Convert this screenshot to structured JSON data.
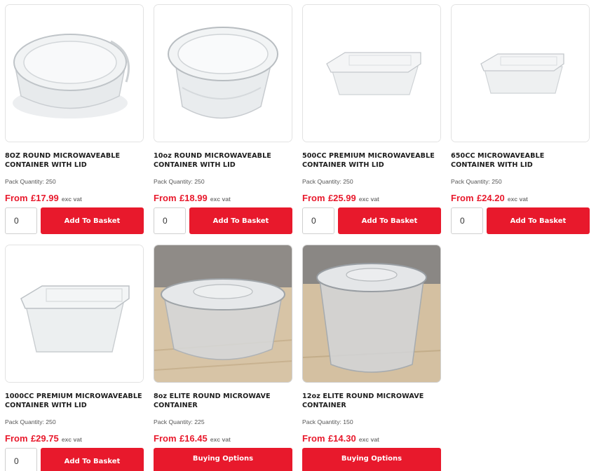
{
  "common": {
    "qty_value": "0",
    "add_to_basket": "Add To Basket",
    "buying_options": "Buying Options",
    "from_label": "From",
    "exc_vat": "exc vat",
    "pack_label": "Pack Quantity:"
  },
  "products": [
    {
      "title": "8OZ ROUND MICROWAVEABLE CONTAINER WITH LID",
      "pack_qty": "250",
      "price": "£17.99",
      "image": "round-container-white",
      "action": "add_to_basket"
    },
    {
      "title": "10oz ROUND MICROWAVEABLE CONTAINER WITH LID",
      "pack_qty": "250",
      "price": "£18.99",
      "image": "round-container-white",
      "action": "add_to_basket"
    },
    {
      "title": "500CC PREMIUM MICROWAVEABLE CONTAINER WITH LID",
      "pack_qty": "250",
      "price": "£25.99",
      "image": "rectangular-container-small",
      "action": "add_to_basket"
    },
    {
      "title": "650CC MICROWAVEABLE CONTAINER WITH LID",
      "pack_qty": "250",
      "price": "£24.20",
      "image": "rectangular-container-small",
      "action": "add_to_basket"
    },
    {
      "title": "1000CC PREMIUM MICROWAVEABLE CONTAINER WITH LID",
      "pack_qty": "250",
      "price": "£29.75",
      "image": "rectangular-container-large",
      "action": "add_to_basket"
    },
    {
      "title": "8oz ELITE ROUND MICROWAVE CONTAINER",
      "pack_qty": "225",
      "price": "£16.45",
      "image": "round-container-photo",
      "action": "buying_options"
    },
    {
      "title": "12oz ELITE ROUND MICROWAVE CONTAINER",
      "pack_qty": "150",
      "price": "£14.30",
      "image": "tall-round-container-photo",
      "action": "buying_options"
    }
  ],
  "colors": {
    "accent": "#e8192c",
    "border": "#e2e2e2",
    "text": "#1c1c1c",
    "muted": "#555555"
  }
}
